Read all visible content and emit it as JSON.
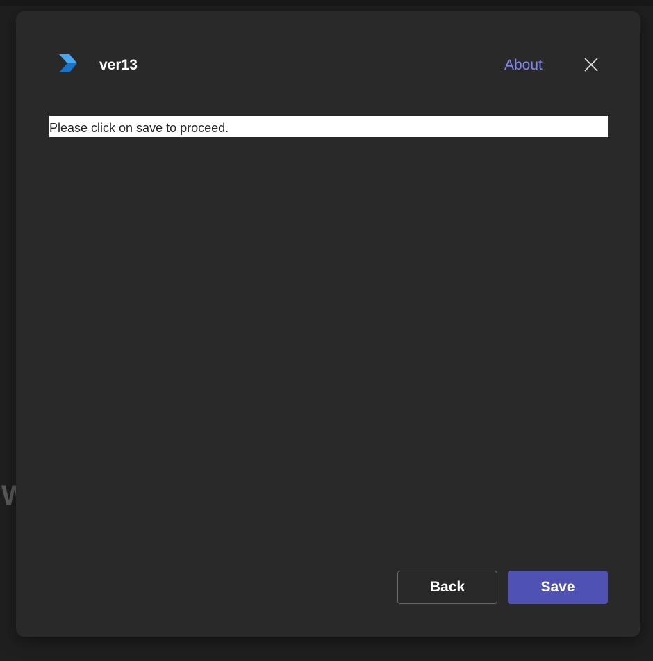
{
  "background": {
    "fragment_text": "W"
  },
  "dialog": {
    "app_icon": "app-chevron-logo-icon",
    "app_name": "ver13",
    "about_label": "About",
    "close_icon": "close-icon",
    "message": "Please click on save to proceed.",
    "back_label": "Back",
    "save_label": "Save"
  },
  "colors": {
    "accent": "#4f52b2",
    "link": "#7f85f5",
    "dialog_bg": "#292929",
    "page_bg": "#1f1f1f",
    "logo_light": "#4aa8f0",
    "logo_dark": "#1a73c9"
  }
}
